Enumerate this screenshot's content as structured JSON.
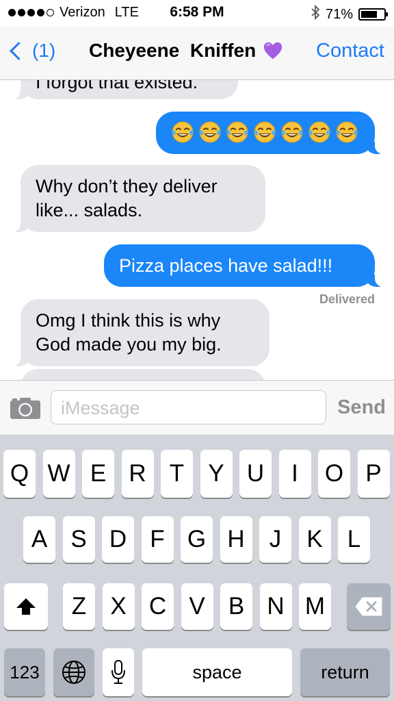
{
  "status_bar": {
    "carrier": "Verizon",
    "network": "LTE",
    "time": "6:58 PM",
    "battery": "71%",
    "battery_level": 0.71,
    "bluetooth_icon": "bluetooth-icon",
    "signal_bars_filled": 4,
    "signal_bars_total": 5
  },
  "nav": {
    "back_label": "(1)",
    "title": "Cheyeene  Kniffen",
    "title_emoji": "purple-heart",
    "contact_label": "Contact"
  },
  "messages": [
    {
      "direction": "incoming",
      "text": "I forgot that existed."
    },
    {
      "direction": "outgoing",
      "emoji": "face-with-tears-of-joy",
      "emoji_count": 7
    },
    {
      "direction": "incoming",
      "text": "Why don’t they deliver like... salads."
    },
    {
      "direction": "outgoing",
      "text": "Pizza places have salad!!!"
    },
    {
      "direction": "incoming",
      "text": "Omg I think this is why God made you my big."
    }
  ],
  "delivered_label": "Delivered",
  "input": {
    "placeholder": "iMessage",
    "send_label": "Send",
    "camera_icon": "camera-icon"
  },
  "keyboard": {
    "row1": [
      "Q",
      "W",
      "E",
      "R",
      "T",
      "Y",
      "U",
      "I",
      "O",
      "P"
    ],
    "row2": [
      "A",
      "S",
      "D",
      "F",
      "G",
      "H",
      "J",
      "K",
      "L"
    ],
    "row3": [
      "Z",
      "X",
      "C",
      "V",
      "B",
      "N",
      "M"
    ],
    "numbers_label": "123",
    "space_label": "space",
    "return_label": "return",
    "shift_icon": "shift-icon",
    "delete_icon": "delete-icon",
    "globe_icon": "globe-icon",
    "mic_icon": "microphone-icon"
  },
  "colors": {
    "ios_blue": "#1b7cf6",
    "outgoing_bubble": "#1b86f7",
    "incoming_bubble": "#e5e5ea",
    "keyboard_bg": "#d1d5db"
  }
}
